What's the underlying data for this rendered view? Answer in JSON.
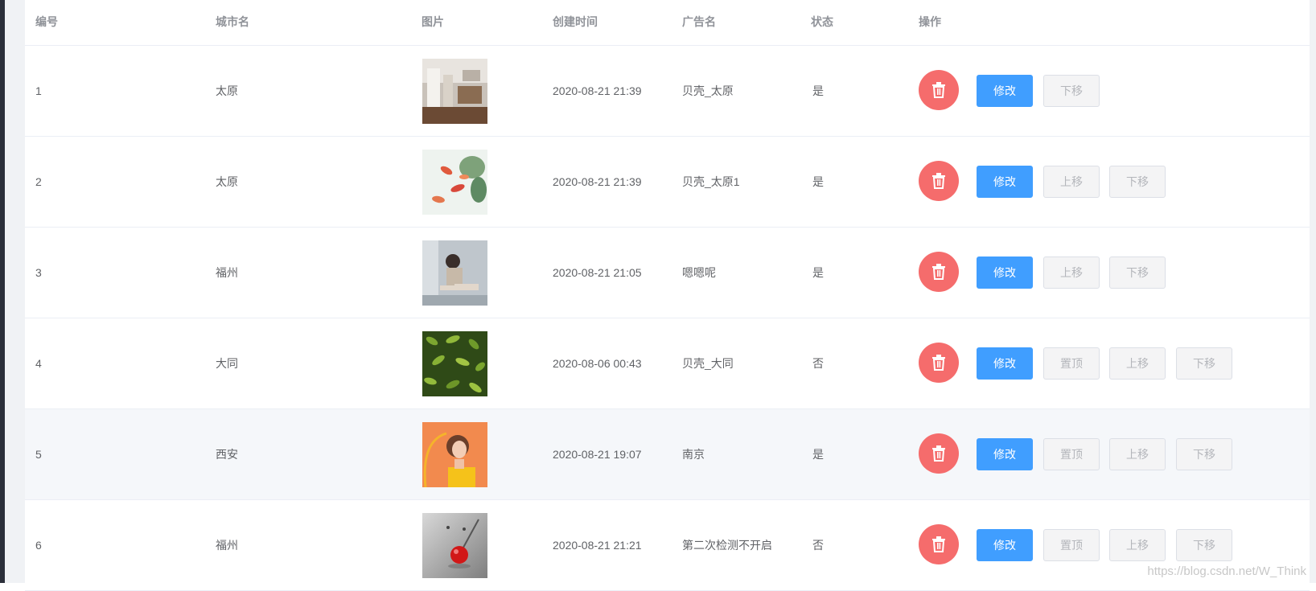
{
  "table": {
    "headers": {
      "id": "编号",
      "city": "城市名",
      "image": "图片",
      "created": "创建时间",
      "ad_name": "广告名",
      "status": "状态",
      "actions": "操作"
    },
    "button_labels": {
      "edit": "修改",
      "top": "置顶",
      "up": "上移",
      "down": "下移"
    },
    "rows": [
      {
        "id": "1",
        "city": "太原",
        "image_icon": "room-interior-photo",
        "created": "2020-08-21 21:39",
        "ad_name": "贝壳_太原",
        "status": "是",
        "buttons": [
          "edit",
          "down"
        ]
      },
      {
        "id": "2",
        "city": "太原",
        "image_icon": "koi-fish-painting",
        "created": "2020-08-21 21:39",
        "ad_name": "贝壳_太原1",
        "status": "是",
        "buttons": [
          "edit",
          "up",
          "down"
        ]
      },
      {
        "id": "3",
        "city": "福州",
        "image_icon": "girl-sitting-photo",
        "created": "2020-08-21 21:05",
        "ad_name": "嗯嗯呢",
        "status": "是",
        "buttons": [
          "edit",
          "up",
          "down"
        ]
      },
      {
        "id": "4",
        "city": "大同",
        "image_icon": "green-leaves-photo",
        "created": "2020-08-06 00:43",
        "ad_name": "贝壳_大同",
        "status": "否",
        "buttons": [
          "edit",
          "top",
          "up",
          "down"
        ]
      },
      {
        "id": "5",
        "city": "西安",
        "image_icon": "woman-orange-portrait",
        "created": "2020-08-21 19:07",
        "ad_name": "南京",
        "status": "是",
        "buttons": [
          "edit",
          "top",
          "up",
          "down"
        ]
      },
      {
        "id": "6",
        "city": "福州",
        "image_icon": "red-ball-pin-photo",
        "created": "2020-08-21 21:21",
        "ad_name": "第二次检测不开启",
        "status": "否",
        "buttons": [
          "edit",
          "top",
          "up",
          "down"
        ]
      }
    ]
  },
  "watermark": "https://blog.csdn.net/W_Think",
  "colors": {
    "primary": "#409eff",
    "danger": "#f56c6c",
    "header_text": "#909399",
    "body_text": "#606266",
    "row_hover": "#f5f7fa",
    "border": "#ebeef5"
  }
}
